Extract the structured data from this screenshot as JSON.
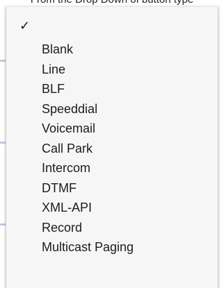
{
  "background": {
    "heading": "From the Drop Down of button type"
  },
  "menu": {
    "checkmark": "✓",
    "items": [
      {
        "label": "Blank"
      },
      {
        "label": "Line"
      },
      {
        "label": "BLF"
      },
      {
        "label": "Speeddial"
      },
      {
        "label": "Voicemail"
      },
      {
        "label": "Call Park"
      },
      {
        "label": "Intercom"
      },
      {
        "label": "DTMF"
      },
      {
        "label": "XML-API"
      },
      {
        "label": "Record"
      },
      {
        "label": "Multicast Paging"
      }
    ]
  }
}
